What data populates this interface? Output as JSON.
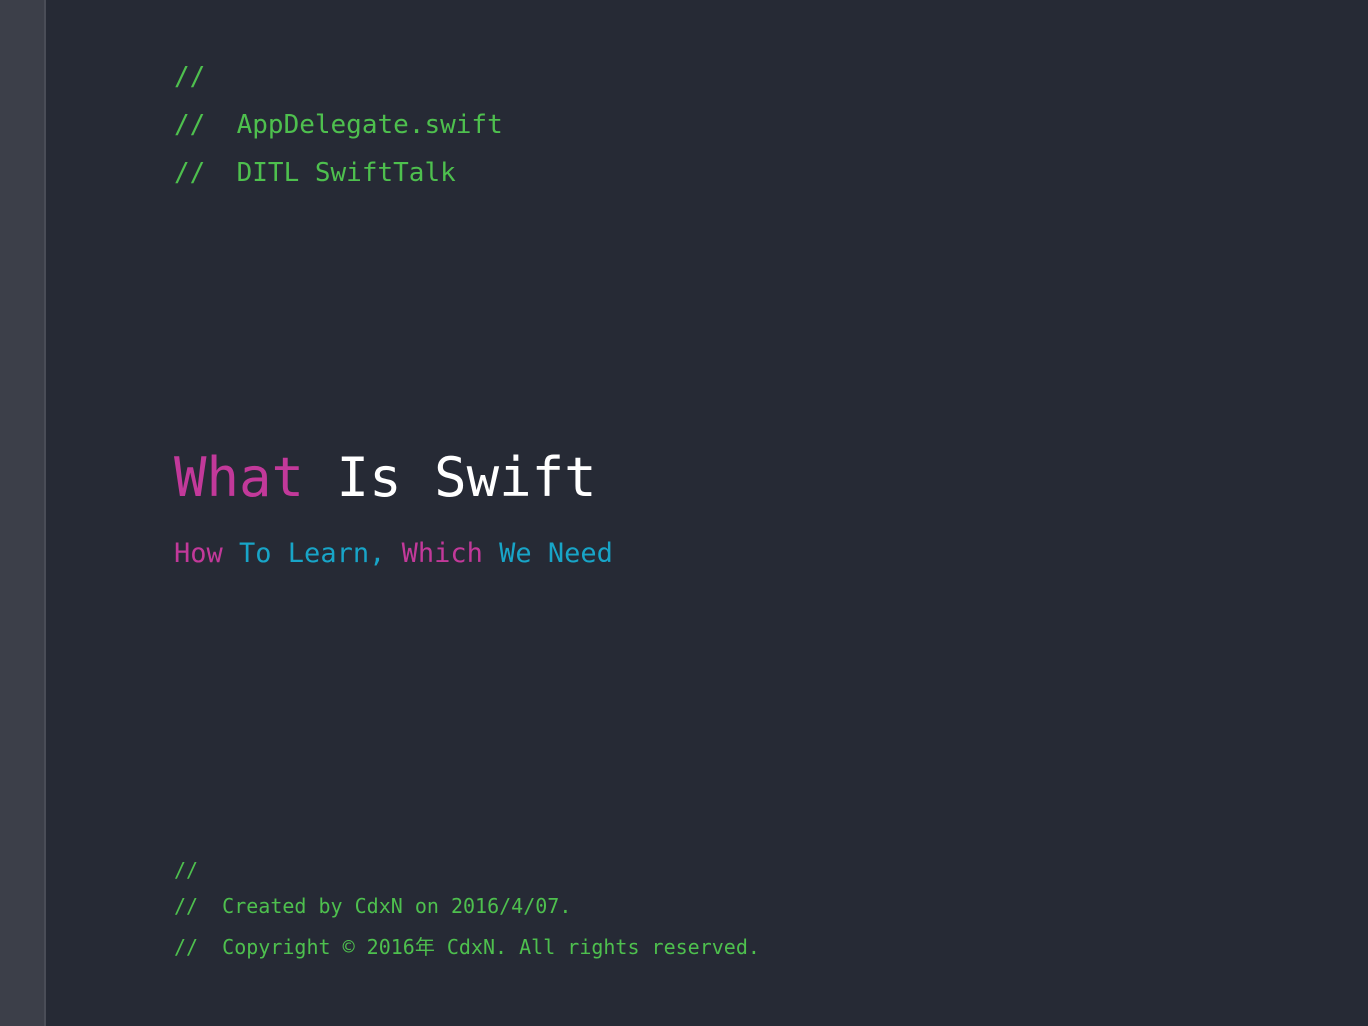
{
  "header_comments": {
    "line1": "//",
    "line2": "//  AppDelegate.swift",
    "line3": "//  DITL SwiftTalk"
  },
  "title": {
    "word1": "What",
    "word2": " Is Swift"
  },
  "subtitle": {
    "w1": "How",
    "w2": " To Learn,",
    "w3": " Which",
    "w4": " We Need"
  },
  "footer_comments": {
    "line1": "//",
    "line2": "//  Created by CdxN on 2016/4/07.",
    "line3": "//  Copyright © 2016年 CdxN. All rights reserved."
  },
  "colors": {
    "background": "#262a35",
    "gutter": "#3c3f49",
    "comment": "#4ec04e",
    "keyword_magenta": "#c2399a",
    "keyword_cyan": "#18a5c8",
    "text_white": "#ffffff"
  }
}
